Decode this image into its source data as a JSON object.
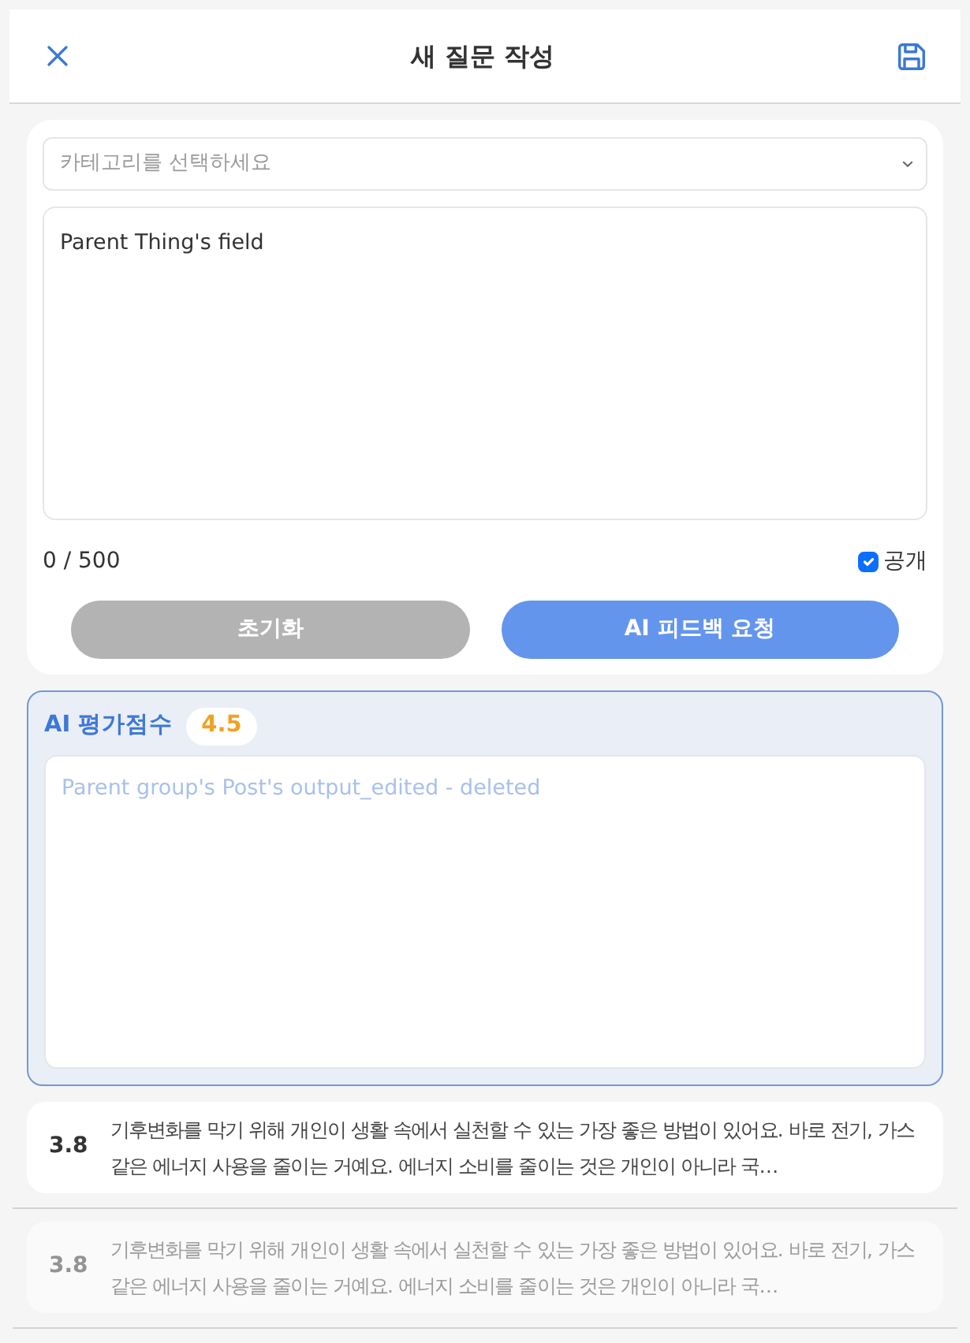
{
  "header": {
    "title": "새 질문 작성"
  },
  "form": {
    "category": {
      "placeholder": "카테고리를 선택하세요"
    },
    "content": {
      "value": "Parent Thing's field"
    },
    "counter": "0 / 500",
    "public": {
      "label": "공개",
      "checked": true
    },
    "buttons": [
      {
        "label": "초기화",
        "disabled": true
      },
      {
        "label": "AI 피드백 요청",
        "disabled": false
      }
    ]
  },
  "ai_feedback": {
    "title": "AI 평가점수",
    "score": "4.5",
    "placeholder": "Parent group's Post's output_edited - deleted"
  },
  "history": [
    {
      "score": "3.8",
      "text": "기후변화를 막기 위해 개인이 생활 속에서 실천할 수 있는 가장 좋은 방법이 있어요. 바로 전기, 가스 같은 에너지 사용을 줄이는 거예요. 에너지 소비를 줄이는 것은 개인이 아니라 국…",
      "disabled": false
    },
    {
      "score": "3.8",
      "text": "기후변화를 막기 위해 개인이 생활 속에서 실천할 수 있는 가장 좋은 방법이 있어요. 바로 전기, 가스 같은 에너지 사용을 줄이는 거예요. 에너지 소비를 줄이는 것은 개인이 아니라 국…",
      "disabled": true
    }
  ]
}
